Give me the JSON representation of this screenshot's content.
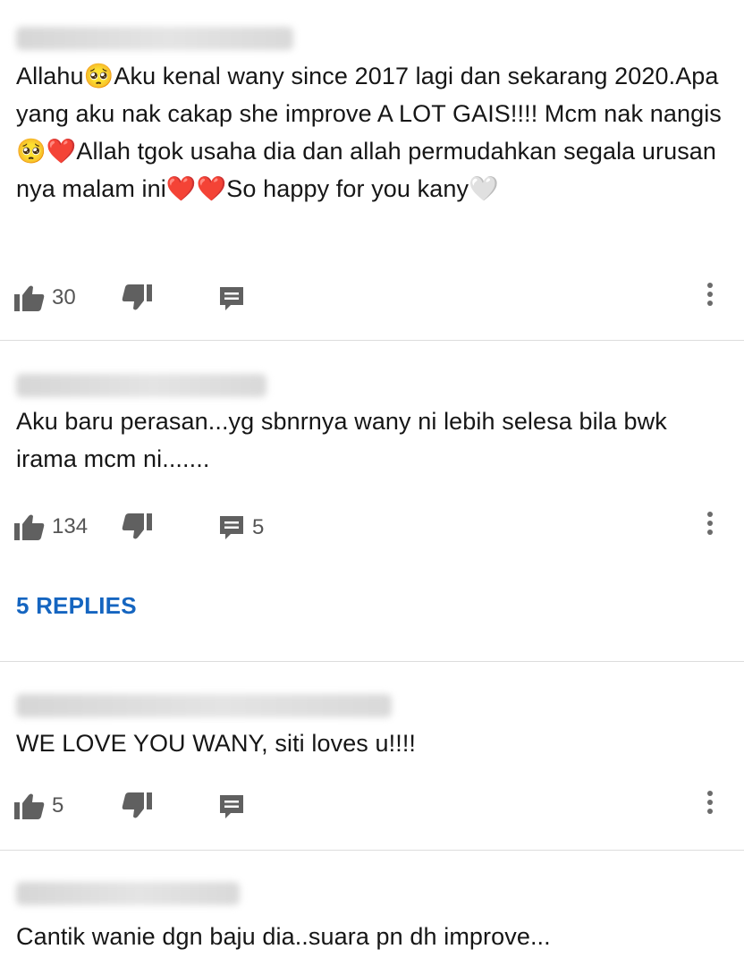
{
  "comments": [
    {
      "text": "Allahu🥺Aku kenal wany since 2017 lagi dan sekarang 2020.Apa yang aku nak cakap she improve A LOT GAIS!!!! Mcm nak nangis🥺❤️Allah tgok usaha dia dan allah permudahkan segala urusan nya malam ini❤️❤️So happy for you kany🤍",
      "likes": "30",
      "reply_count": ""
    },
    {
      "text": "Aku baru perasan...yg sbnrnya wany ni lebih selesa bila bwk irama mcm ni.......",
      "likes": "134",
      "reply_count": "5",
      "replies_link": "5 REPLIES"
    },
    {
      "text": "WE LOVE YOU WANY, siti loves u!!!!",
      "likes": "5",
      "reply_count": ""
    },
    {
      "text": "Cantik wanie dgn baju dia..suara pn dh improve...",
      "likes": "",
      "reply_count": ""
    }
  ],
  "icons": {
    "like": "thumb-up-icon",
    "dislike": "thumb-down-icon",
    "reply": "reply-comment-icon",
    "menu": "more-vert-icon"
  },
  "colors": {
    "link": "#1565c0",
    "icon": "#606060",
    "divider": "#dcdcdc"
  }
}
